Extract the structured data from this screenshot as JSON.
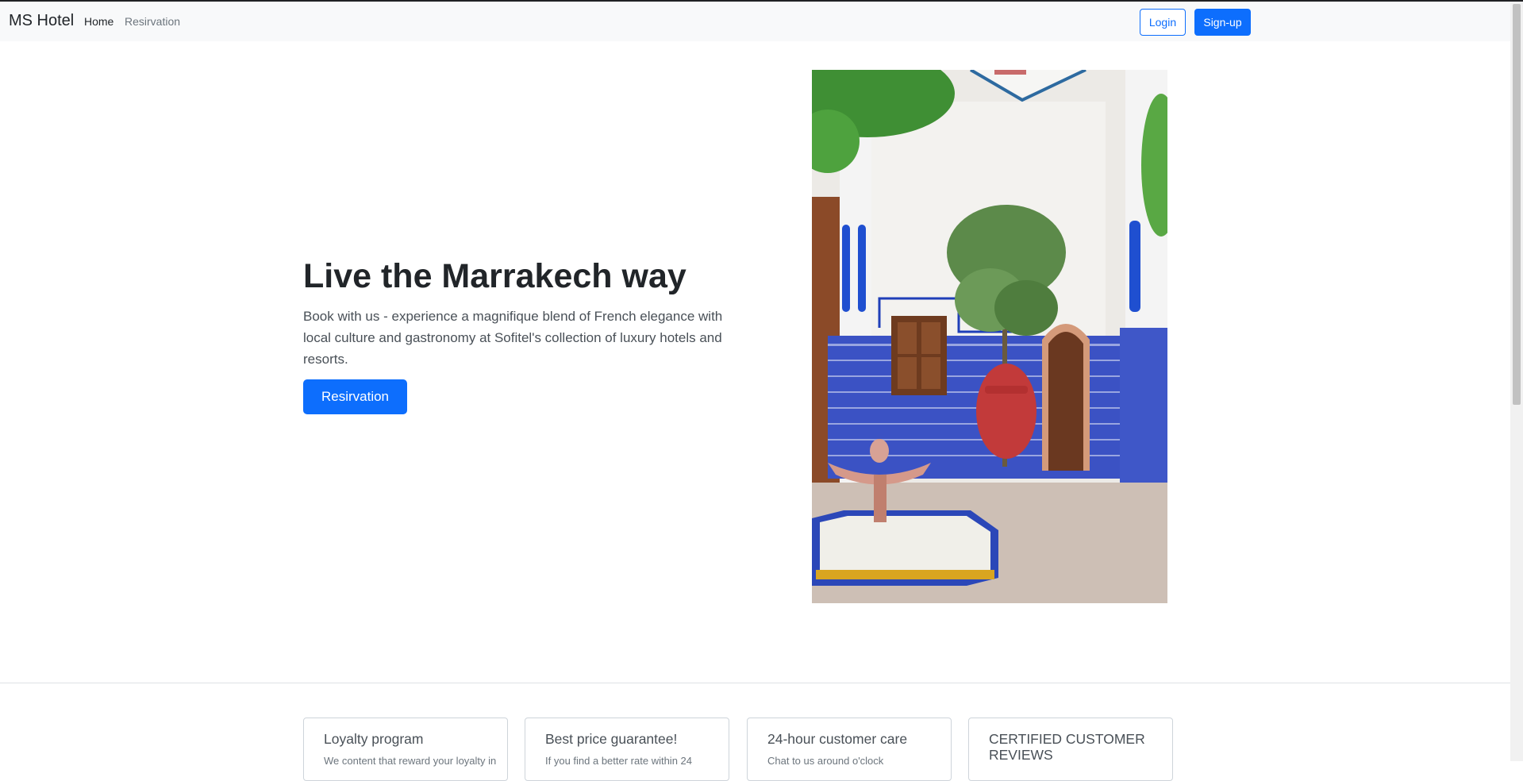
{
  "navbar": {
    "brand": "MS Hotel",
    "links": [
      "Home",
      "Resirvation"
    ],
    "login_label": "Login",
    "signup_label": "Sign-up"
  },
  "hero": {
    "title": "Live the Marrakech way",
    "text": "Book with us - experience a magnifique blend of French elegance with local culture and gastronomy at Sofitel's collection of luxury hotels and resorts.",
    "button_label": "Resirvation",
    "image_alt": "Moroccan riad courtyard with tiled fountain and potted tree"
  },
  "cards": [
    {
      "title": "Loyalty program",
      "text": "We content that reward your loyalty in"
    },
    {
      "title": "Best price guarantee!",
      "text": "If you find a better rate within 24"
    },
    {
      "title": "24-hour customer care",
      "text": "Chat to us around o'clock"
    },
    {
      "title": "CERTIFIED CUSTOMER REVIEWS",
      "text": ""
    }
  ],
  "colors": {
    "primary": "#0d6efd",
    "navbar_bg": "#f8f9fa",
    "text": "#212529",
    "muted": "#6c757d"
  }
}
